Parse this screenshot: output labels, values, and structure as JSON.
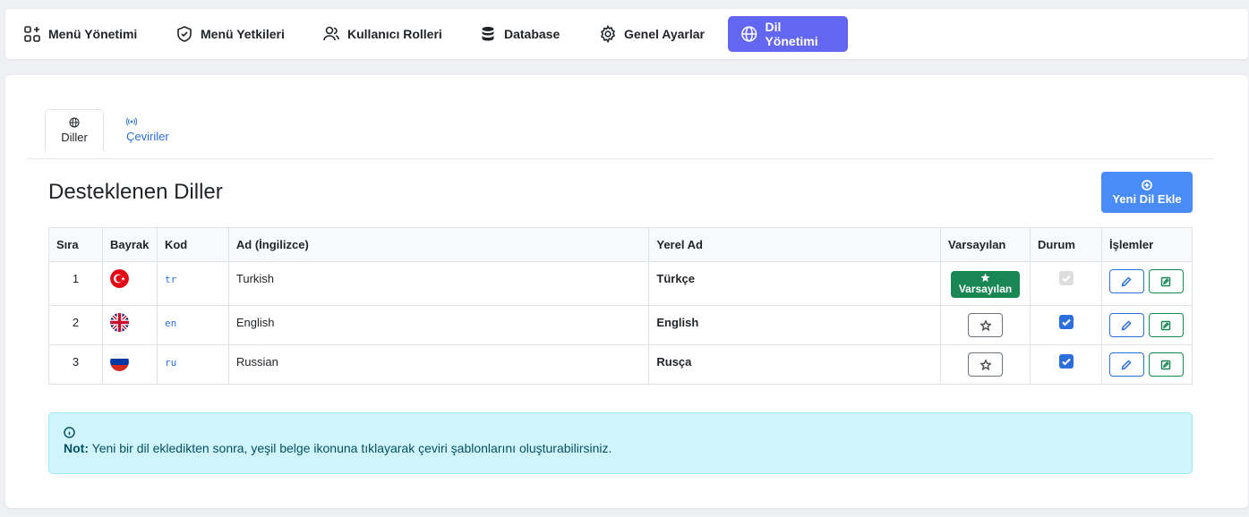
{
  "nav": [
    {
      "label": "Menü Yönetimi",
      "icon": "grid-plus-icon",
      "active": false
    },
    {
      "label": "Menü Yetkileri",
      "icon": "shield-check-icon",
      "active": false
    },
    {
      "label": "Kullanıcı Rolleri",
      "icon": "users-icon",
      "active": false
    },
    {
      "label": "Database",
      "icon": "database-icon",
      "active": false
    },
    {
      "label": "Genel Ayarlar",
      "icon": "gear-icon",
      "active": false
    },
    {
      "label": "Dil Yönetimi",
      "icon": "globe-icon",
      "active": true
    }
  ],
  "tabs": [
    {
      "label": "Diller",
      "icon": "globe-icon",
      "active": true
    },
    {
      "label": "Çeviriler",
      "icon": "broadcast-icon",
      "active": false
    }
  ],
  "page_title": "Desteklenen Diller",
  "add_button_label": "Yeni Dil Ekle",
  "table": {
    "headers": [
      "Sıra",
      "Bayrak",
      "Kod",
      "Ad (İngilizce)",
      "Yerel Ad",
      "Varsayılan",
      "Durum",
      "İşlemler"
    ],
    "rows": [
      {
        "order": "1",
        "flag": "turkey-flag",
        "code": "tr",
        "name_en": "Turkish",
        "native": "Türkçe",
        "is_default": true,
        "default_label": "Varsayılan",
        "active": true,
        "disabled": true
      },
      {
        "order": "2",
        "flag": "uk-flag",
        "code": "en",
        "name_en": "English",
        "native": "English",
        "is_default": false,
        "active": true,
        "disabled": false
      },
      {
        "order": "3",
        "flag": "russia-flag",
        "code": "ru",
        "name_en": "Russian",
        "native": "Rusça",
        "is_default": false,
        "active": true,
        "disabled": false
      }
    ]
  },
  "note": {
    "label": "Not:",
    "text": "Yeni bir dil ekledikten sonra, yeşil belge ikonuna tıklayarak çeviri şablonlarını oluşturabilirsiniz."
  },
  "colors": {
    "nav_active": "#6366f1",
    "primary": "#2a6fdb",
    "success": "#198754",
    "info_bg": "#cff4fc"
  }
}
